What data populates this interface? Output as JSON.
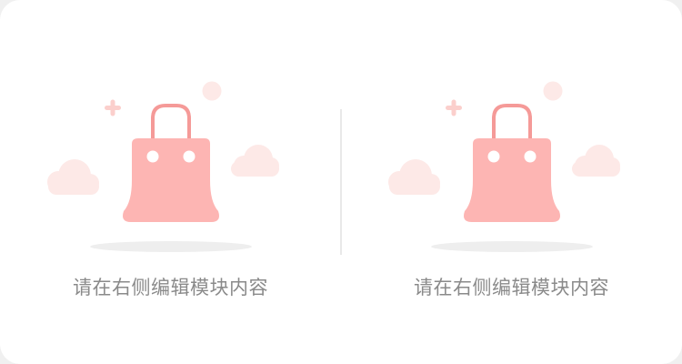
{
  "empty_state": {
    "left_message": "请在右侧编辑模块内容",
    "right_message": "请在右侧编辑模块内容",
    "icon": "shopping-bag-icon"
  },
  "colors": {
    "bag": "#fdb5b3",
    "handle": "#f59a98",
    "cloud": "#fde9e7",
    "plus": "#fbcfcc",
    "shadow": "#eeeeee",
    "text": "#8a8a8a"
  }
}
